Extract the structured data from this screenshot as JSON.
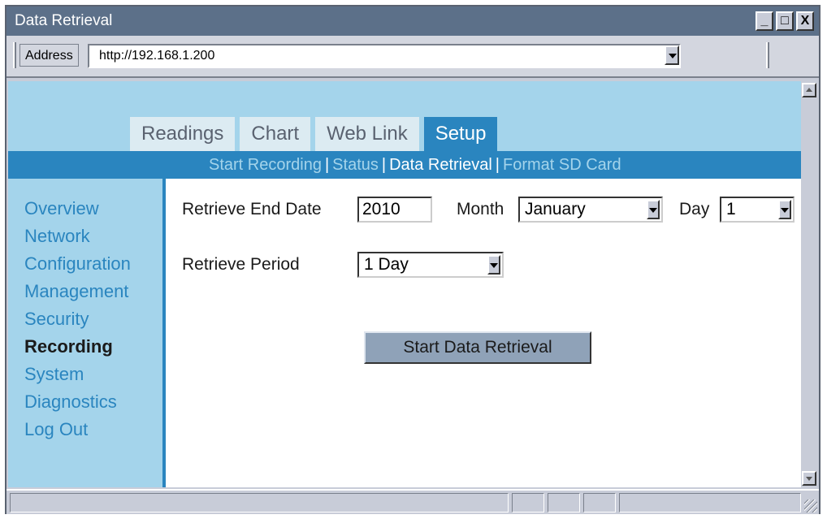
{
  "window": {
    "title": "Data Retrieval",
    "controls": [
      "_",
      "□",
      "X"
    ]
  },
  "address": {
    "label": "Address",
    "url": "http://192.168.1.200"
  },
  "tabs": [
    "Readings",
    "Chart",
    "Web Link",
    "Setup"
  ],
  "active_tab": "Setup",
  "subnav": {
    "start_recording": "Start Recording",
    "status": "Status",
    "data_retrieval": "Data Retrieval",
    "format_sd": "Format SD Card"
  },
  "sidebar": {
    "items": [
      "Overview",
      "Network",
      "Configuration",
      "Management",
      "Security",
      "Recording",
      "System",
      "Diagnostics",
      "Log Out"
    ],
    "active": "Recording"
  },
  "form": {
    "end_date_label": "Retrieve End Date",
    "year_value": "2010",
    "month_label": "Month",
    "month_value": "January",
    "day_label": "Day",
    "day_value": "1",
    "period_label": "Retrieve Period",
    "period_value": "1 Day",
    "start_button": "Start Data Retrieval"
  },
  "colors": {
    "accent": "#2a85bf",
    "light_accent": "#a4d4eb",
    "title_bar": "#5c7089",
    "button": "#8fa2b8"
  }
}
